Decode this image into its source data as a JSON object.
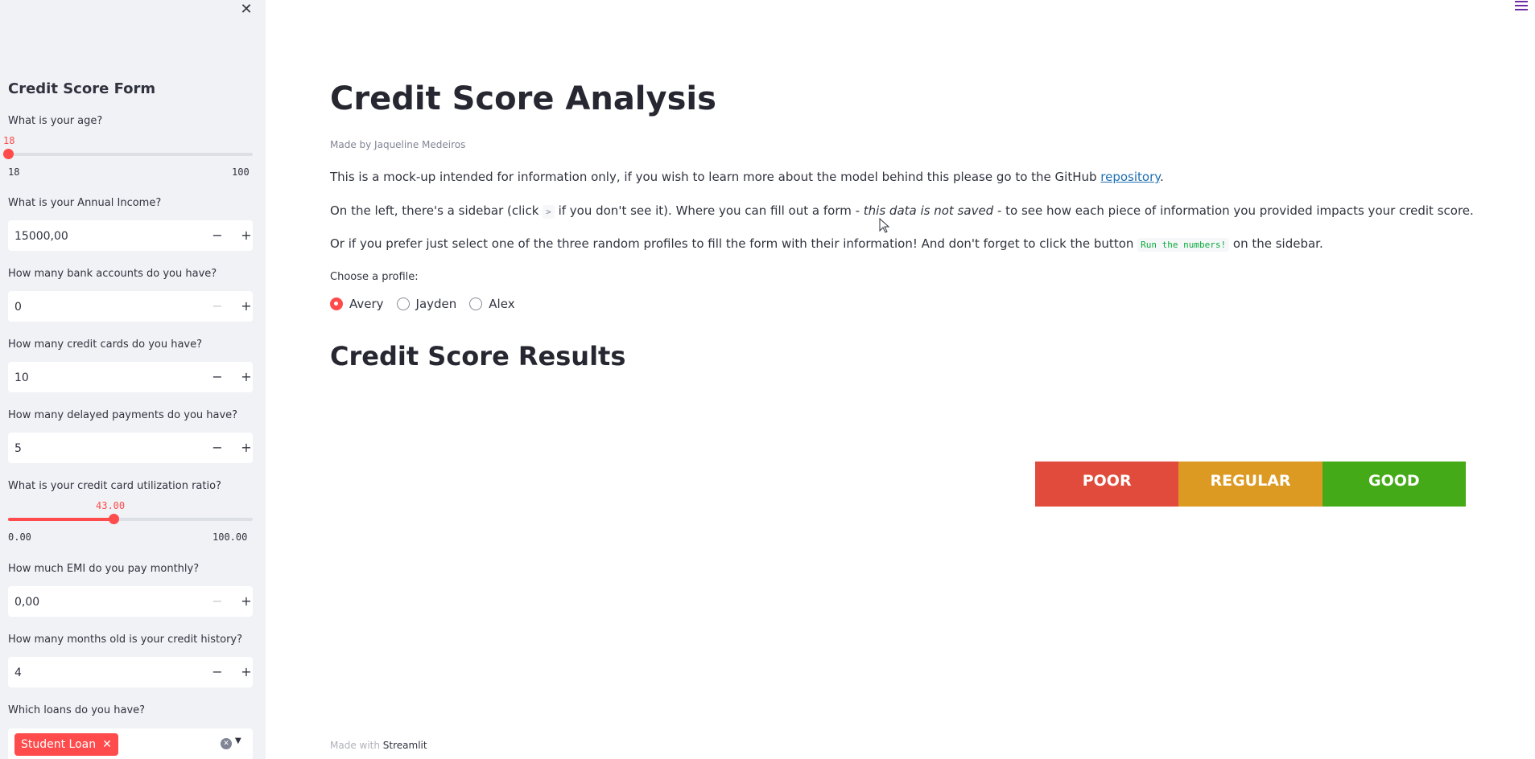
{
  "sidebar": {
    "close_icon": "close-icon",
    "title": "Credit Score Form",
    "age": {
      "label": "What is your age?",
      "value": "18",
      "min": "18",
      "max": "100",
      "fraction": 0.0
    },
    "income": {
      "label": "What is your Annual Income?",
      "value": "15000,00"
    },
    "bank_accounts": {
      "label": "How many bank accounts do you have?",
      "value": "0"
    },
    "credit_cards": {
      "label": "How many credit cards do you have?",
      "value": "10"
    },
    "delayed_payments": {
      "label": "How many delayed payments do you have?",
      "value": "5"
    },
    "utilization": {
      "label": "What is your credit card utilization ratio?",
      "value": "43.00",
      "min": "0.00",
      "max": "100.00",
      "fraction": 0.43
    },
    "emi": {
      "label": "How much EMI do you pay monthly?",
      "value": "0,00"
    },
    "credit_history": {
      "label": "How many months old is your credit history?",
      "value": "4"
    },
    "loans": {
      "label": "Which loans do you have?",
      "selected": [
        "Student Loan"
      ]
    },
    "minus": "−",
    "plus": "+"
  },
  "main": {
    "menu_icon": "hamburger-icon",
    "title": "Credit Score Analysis",
    "made_by": "Made by Jaqueline Medeiros",
    "p1": {
      "text": "This is a mock-up intended for information only, if you wish to learn more about the model behind this please go to the GitHub ",
      "link": "repository",
      "end": "."
    },
    "p2": {
      "before": "On the left, there's a sidebar (click ",
      "chevron": ">",
      "middle": " if you don't see it). Where you can fill out a form - ",
      "emph": "this data is not saved",
      "after": " - to see how each piece of information you provided impacts your credit score."
    },
    "p3": {
      "before": "Or if you prefer just select one of the three random profiles to fill the form with their information! And don't forget to click the button ",
      "code": "Run the numbers!",
      "after": " on the sidebar."
    },
    "choose_label": "Choose a profile:",
    "profiles": [
      "Avery",
      "Jayden",
      "Alex"
    ],
    "selected_profile": "Avery",
    "results_title": "Credit Score Results",
    "score_bar": [
      {
        "label": "POOR",
        "color": "#e14b3b"
      },
      {
        "label": "REGULAR",
        "color": "#dc9a22"
      },
      {
        "label": "GOOD",
        "color": "#44aa18"
      }
    ],
    "footer": {
      "prefix": "Made with ",
      "brand": "Streamlit"
    }
  }
}
